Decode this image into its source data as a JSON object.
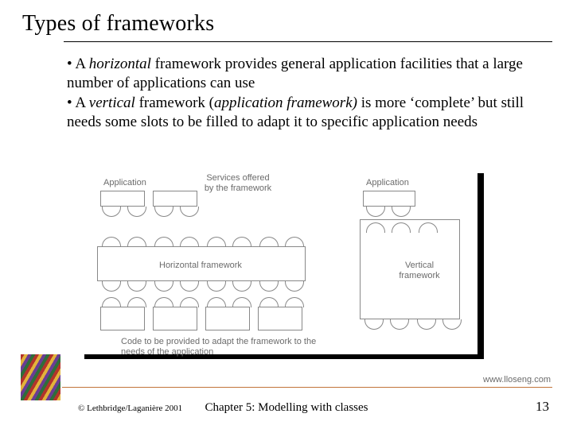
{
  "title": "Types of frameworks",
  "bullets": {
    "b1_pre": "• A ",
    "b1_em": "horizontal",
    "b1_post": " framework provides general application facilities that a large number of applications can use",
    "b2_pre": "• A ",
    "b2_em": "vertical",
    "b2_mid": " framework (",
    "b2_em2": "application framework)",
    "b2_post": " is more ‘complete’ but still needs some slots to be filled to adapt it to specific application needs"
  },
  "diagram": {
    "app_label_left": "Application",
    "app_label_right": "Application",
    "services_label": "Services offered\nby the framework",
    "h_framework_label": "Horizontal framework",
    "v_framework_label": "Vertical\nframework",
    "bottom_caption": "Code to be provided to adapt the framework to the\nneeds of the application"
  },
  "url": "www.lloseng.com",
  "copyright": "© Lethbridge/Laganière 2001",
  "chapter": "Chapter 5: Modelling with classes",
  "page": "13"
}
